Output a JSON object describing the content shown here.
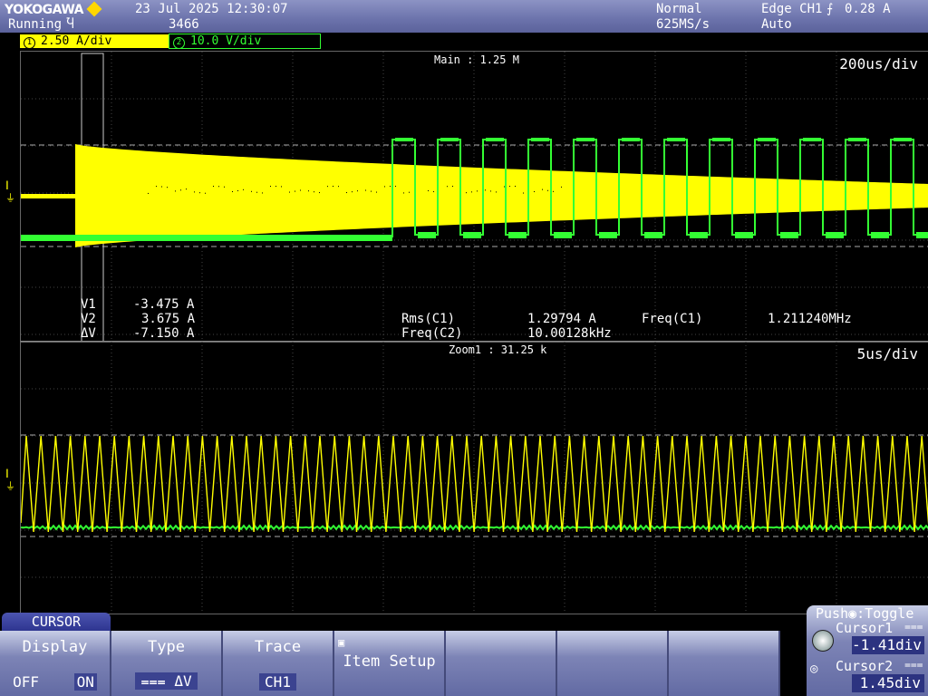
{
  "header": {
    "brand": "YOKOGAWA",
    "status": "Running",
    "status_icon": "acquire-icon",
    "date": "23 Jul 2025 12:30:07",
    "count": "3466",
    "acq_mode": "Normal",
    "sample_rate": "625MS/s",
    "trigger": "Edge CH1",
    "trigger_slope_icon": "rising-edge-icon",
    "trigger_level": "0.28 A",
    "trigger_mode": "Auto"
  },
  "channels": {
    "ch1": {
      "number": "1",
      "scale": "2.50 A/div",
      "color": "#ffff00"
    },
    "ch2": {
      "number": "2",
      "scale": "10.0 V/div",
      "color": "#33ff33"
    }
  },
  "main": {
    "label": "Main : 1.25 M",
    "timebase": "200us/div"
  },
  "cursor_readout": {
    "v1_label": "V1",
    "v1_value": "-3.475 A",
    "v2_label": "V2",
    "v2_value": "3.675 A",
    "dv_label": "ΔV",
    "dv_value": "-7.150 A"
  },
  "measurements": {
    "rms_c1_label": "Rms(C1)",
    "rms_c1_value": "1.29794 A",
    "freq_c2_label": "Freq(C2)",
    "freq_c2_value": "10.00128kHz",
    "freq_c1_label": "Freq(C1)",
    "freq_c1_value": "1.211240MHz"
  },
  "zoom": {
    "label": "Zoom1 : 31.25 k",
    "timebase": "5us/div"
  },
  "menu": {
    "title": "CURSOR",
    "display_label": "Display",
    "display_off": "OFF",
    "display_on": "ON",
    "type_label": "Type",
    "type_value": "ΔV",
    "trace_label": "Trace",
    "trace_value": "CH1",
    "item_setup_label": "Item Setup"
  },
  "jog": {
    "push_label": "Push",
    "toggle_label": ":Toggle",
    "cursor1_label": "Cursor1",
    "cursor1_value": "-1.41div",
    "cursor2_label": "Cursor2",
    "cursor2_value": "1.45div"
  }
}
